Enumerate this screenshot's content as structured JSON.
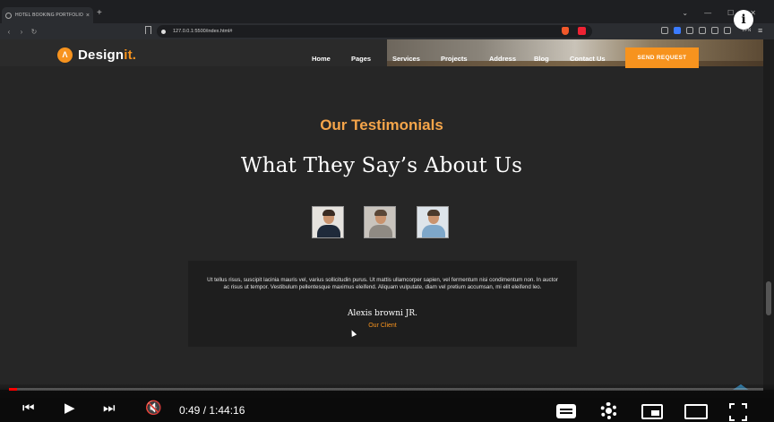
{
  "browser": {
    "tab_title": "HOTEL BOOKING PORTFOLIO",
    "tab_close": "×",
    "new_tab": "+",
    "window_controls": [
      "⌄",
      "—",
      "☐",
      "✕"
    ],
    "nav_back": "‹",
    "nav_forward": "›",
    "reload": "↻",
    "url": "127.0.0.1:5500/index.html#",
    "vpn_label": "VPN",
    "menu": "≡",
    "info": "i"
  },
  "site": {
    "logo_badge": "Λ",
    "logo_main": "Design",
    "logo_accent": "it.",
    "nav": [
      "Home",
      "Pages",
      "Services",
      "Projects",
      "Address",
      "Blog",
      "Contact Us"
    ],
    "send_request": "SEND REQUEST",
    "kicker": "Our Testimonials",
    "headline": "What They Say’s About Us",
    "quote": "Ut tellus risus, suscipit lacinia mauris vel, varius sollicitudin purus. Ut mattis ullamcorper sapien, vel fermentum nisi condimentum non. In auctor ac risus ut tempor. Vestibulum pellentesque maximus eleifend. Aliquam vulputate, diam vel pretium accumsan, mi elit eleifend leo.",
    "client_name": "Alexis browni JR.",
    "client_role": "Our Client"
  },
  "player": {
    "progress": 0.011,
    "time": "0:49 / 1:44:16",
    "prev": "⏮",
    "play": "▶",
    "next": "⏭",
    "mute": "🔇"
  },
  "colors": {
    "accent": "#f7931e",
    "page_bg": "#262626",
    "progress": "#ff0000"
  }
}
